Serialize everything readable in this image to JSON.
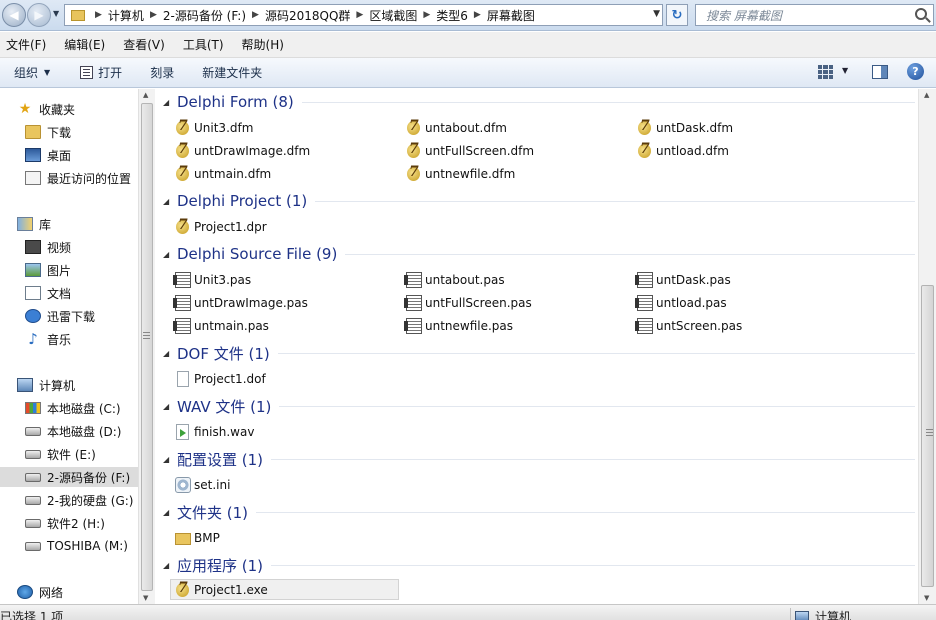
{
  "address_bar": {
    "breadcrumbs": [
      "计算机",
      "2-源码备份 (F:)",
      "源码2018QQ群",
      "区域截图",
      "类型6",
      "屏幕截图"
    ],
    "search_placeholder": "搜索 屏幕截图"
  },
  "menu": [
    "文件(F)",
    "编辑(E)",
    "查看(V)",
    "工具(T)",
    "帮助(H)"
  ],
  "toolbar": {
    "organize": "组织",
    "open": "打开",
    "burn": "刻录",
    "new_folder": "新建文件夹"
  },
  "sidebar": {
    "favorites": {
      "label": "收藏夹",
      "items": [
        "下载",
        "桌面",
        "最近访问的位置"
      ]
    },
    "libraries": {
      "label": "库",
      "items": [
        "视频",
        "图片",
        "文档",
        "迅雷下载",
        "音乐"
      ]
    },
    "computer": {
      "label": "计算机",
      "items": [
        "本地磁盘 (C:)",
        "本地磁盘 (D:)",
        "软件 (E:)",
        "2-源码备份 (F:)",
        "2-我的硬盘 (G:)",
        "软件2 (H:)",
        "TOSHIBA (M:)"
      ],
      "selected": "2-源码备份 (F:)"
    },
    "network": {
      "label": "网络"
    }
  },
  "groups": [
    {
      "title": "Delphi Form (8)",
      "icon": "delphi-icon",
      "files": [
        "Unit3.dfm",
        "untabout.dfm",
        "untDask.dfm",
        "untDrawImage.dfm",
        "untFullScreen.dfm",
        "untload.dfm",
        "untmain.dfm",
        "untnewfile.dfm"
      ]
    },
    {
      "title": "Delphi Project (1)",
      "icon": "delphi-icon",
      "files": [
        "Project1.dpr"
      ]
    },
    {
      "title": "Delphi Source File (9)",
      "icon": "pas-file-icon",
      "files": [
        "Unit3.pas",
        "untabout.pas",
        "untDask.pas",
        "untDrawImage.pas",
        "untFullScreen.pas",
        "untload.pas",
        "untmain.pas",
        "untnewfile.pas",
        "untScreen.pas"
      ]
    },
    {
      "title": "DOF 文件 (1)",
      "icon": "blank-file-icon",
      "files": [
        "Project1.dof"
      ]
    },
    {
      "title": "WAV 文件 (1)",
      "icon": "wav-file-icon",
      "files": [
        "finish.wav"
      ]
    },
    {
      "title": "配置设置 (1)",
      "icon": "ini-file-icon",
      "files": [
        "set.ini"
      ]
    },
    {
      "title": "文件夹 (1)",
      "icon": "folder-icon",
      "files": [
        "BMP"
      ]
    },
    {
      "title": "应用程序 (1)",
      "icon": "delphi-icon",
      "files": [
        "Project1.exe"
      ],
      "selected": "Project1.exe"
    }
  ],
  "status": {
    "selection": "已选择 1 项",
    "location": "计算机"
  }
}
